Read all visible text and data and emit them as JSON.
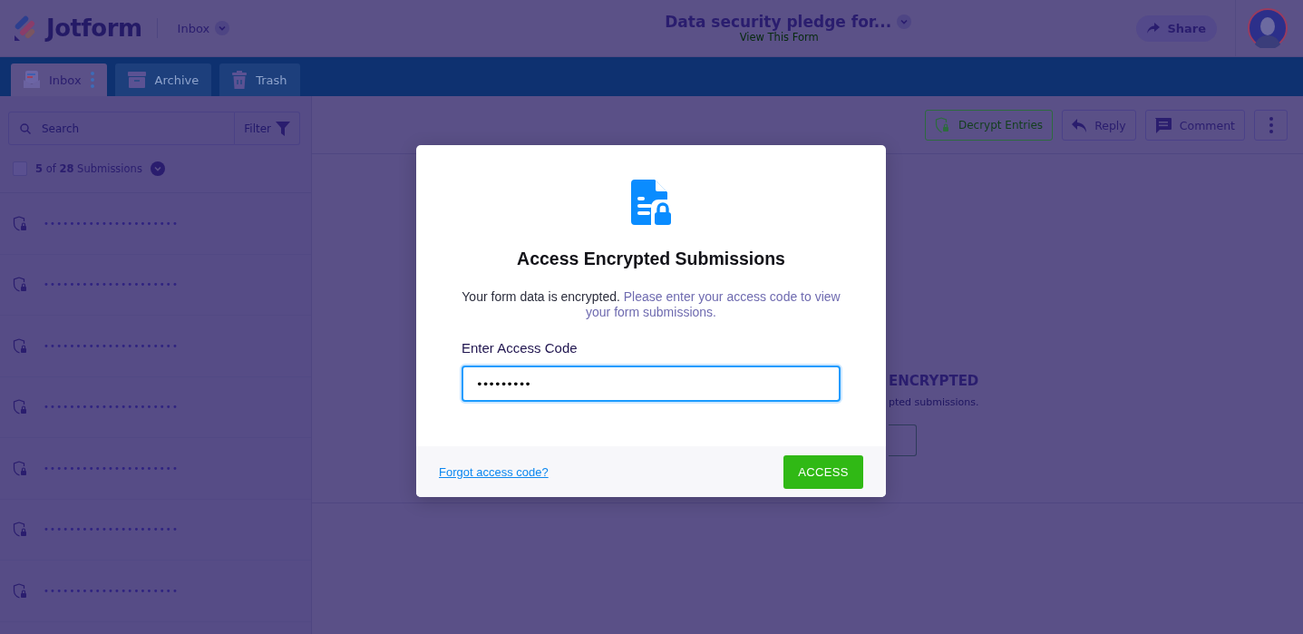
{
  "header": {
    "logo": "Jotform",
    "section": "Inbox",
    "form_title": "Data security pledge for...",
    "form_link": "View This Form",
    "share": "Share"
  },
  "tabs": [
    {
      "label": "Inbox",
      "selected": true,
      "kind": "inbox"
    },
    {
      "label": "Archive",
      "selected": false,
      "kind": "archive"
    },
    {
      "label": "Trash",
      "selected": false,
      "kind": "trash"
    }
  ],
  "sidebar": {
    "search": {
      "placeholder": "Search"
    },
    "filter": "Filter",
    "select_all": {
      "checked": false
    },
    "count": "**5** of **28** Submissions",
    "submissions": [
      {
        "text": "•••••••••••••••••••••"
      },
      {
        "text": "•••••••••••••••••••••"
      },
      {
        "text": "•••••••••••••••••••••"
      },
      {
        "text": "•••••••••••••••••••••"
      },
      {
        "text": "•••••••••••••••••••••"
      },
      {
        "text": "•••••••••••••••••••••"
      },
      {
        "text": "•••••••••••••••••••••"
      }
    ]
  },
  "toolbar": [
    {
      "label": "Decrypt Entries",
      "kind": "decrypt"
    },
    {
      "label": "Reply",
      "kind": "reply"
    },
    {
      "label": "Comment",
      "kind": "comment"
    }
  ],
  "empty_state": {
    "title": "ENCRYPTED",
    "text": "pted submissions."
  },
  "dialog": {
    "title": "Access Encrypted Submissions",
    "text": "Your form data is encrypted.",
    "hint": "Please enter your access code to view your form submissions.",
    "field_label": "Enter Access Code",
    "value": "•••••••••",
    "forgot": "Forgot access code?",
    "button": "ACCESS"
  }
}
